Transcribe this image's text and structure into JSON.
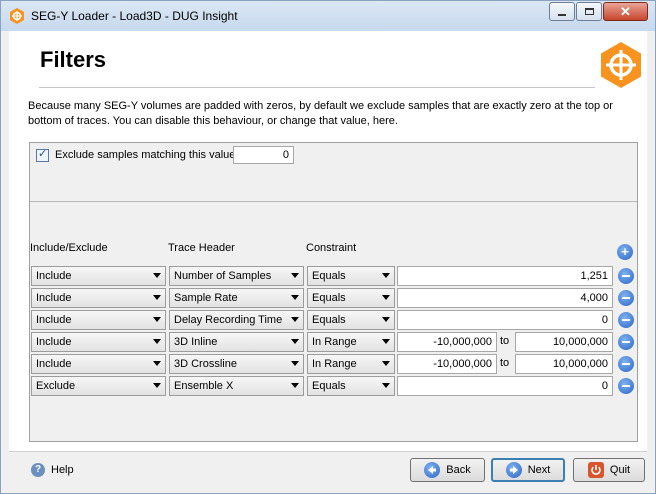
{
  "window": {
    "title": "SEG-Y Loader - Load3D - DUG Insight"
  },
  "page": {
    "heading": "Filters",
    "description": "Because many SEG-Y volumes are padded with zeros, by default we exclude samples that are exactly zero at the top or bottom of traces. You can disable this behaviour, or change that value, here."
  },
  "exclude": {
    "checked": true,
    "label": "Exclude samples matching this value",
    "value": "0"
  },
  "columns": {
    "include_exclude": "Include/Exclude",
    "trace_header": "Trace Header",
    "constraint": "Constraint"
  },
  "range_to_label": "to",
  "rows": [
    {
      "mode": "Include",
      "header": "Number of Samples",
      "constraint": "Equals",
      "value": "1,251"
    },
    {
      "mode": "Include",
      "header": "Sample Rate",
      "constraint": "Equals",
      "value": "4,000"
    },
    {
      "mode": "Include",
      "header": "Delay Recording Time",
      "constraint": "Equals",
      "value": "0"
    },
    {
      "mode": "Include",
      "header": "3D Inline",
      "constraint": "In Range",
      "min": "-10,000,000",
      "max": "10,000,000"
    },
    {
      "mode": "Include",
      "header": "3D Crossline",
      "constraint": "In Range",
      "min": "-10,000,000",
      "max": "10,000,000"
    },
    {
      "mode": "Exclude",
      "header": "Ensemble X",
      "constraint": "Equals",
      "value": "0"
    }
  ],
  "footer": {
    "help": "Help",
    "back": "Back",
    "next": "Next",
    "quit": "Quit"
  },
  "colors": {
    "accent_orange": "#f7931e",
    "button_blue": "#2a65c6",
    "quit_red": "#d9532c"
  },
  "icons": [
    "app-icon",
    "minimize-icon",
    "maximize-icon",
    "close-icon",
    "target-logo-icon",
    "add-icon",
    "remove-icon",
    "help-icon",
    "back-arrow-icon",
    "next-arrow-icon",
    "quit-power-icon"
  ]
}
